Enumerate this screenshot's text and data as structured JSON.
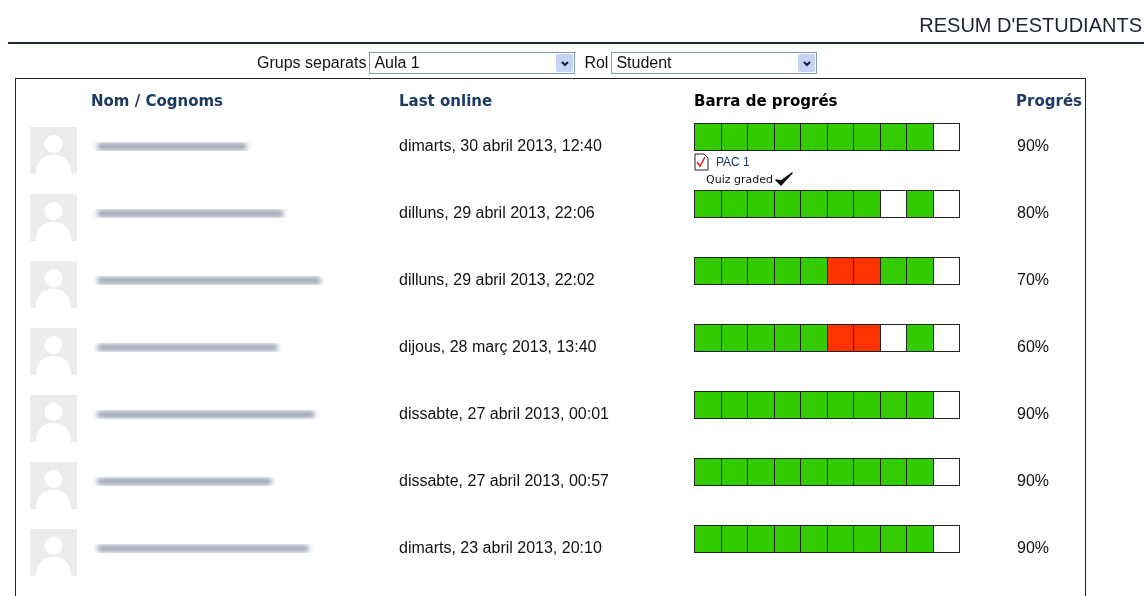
{
  "title": "RESUM D'ESTUDIANTS",
  "filters": [
    {
      "label": "Grups separats",
      "value": "Aula 1"
    },
    {
      "label": "Rol",
      "value": "Student"
    }
  ],
  "table": {
    "columns": [
      {
        "label": "Nom / Cognoms",
        "kind": "link"
      },
      {
        "label": "Last online",
        "kind": "link"
      },
      {
        "label": "Barra de progrés",
        "kind": "plain"
      },
      {
        "label": "Progrés",
        "kind": "link"
      }
    ],
    "rows": [
      {
        "last_online": "dimarts, 30 abril 2013, 12:40",
        "cells": [
          {
            "kind": "done"
          },
          {
            "kind": "done"
          },
          {
            "kind": "done"
          },
          {
            "kind": "done"
          },
          {
            "kind": "done"
          },
          {
            "kind": "done"
          },
          {
            "kind": "done"
          },
          {
            "kind": "done"
          },
          {
            "kind": "done"
          },
          {
            "kind": "pending"
          }
        ],
        "progress": "90%",
        "popup": {
          "activity": "PAC 1",
          "status": "Quiz graded"
        }
      },
      {
        "last_online": "dilluns, 29 abril 2013, 22:06",
        "cells": [
          {
            "kind": "done"
          },
          {
            "kind": "done"
          },
          {
            "kind": "done"
          },
          {
            "kind": "done"
          },
          {
            "kind": "done"
          },
          {
            "kind": "done"
          },
          {
            "kind": "done"
          },
          {
            "kind": "pending"
          },
          {
            "kind": "done"
          },
          {
            "kind": "pending"
          }
        ],
        "progress": "80%"
      },
      {
        "last_online": "dilluns, 29 abril 2013, 22:02",
        "cells": [
          {
            "kind": "done"
          },
          {
            "kind": "done"
          },
          {
            "kind": "done"
          },
          {
            "kind": "done"
          },
          {
            "kind": "done"
          },
          {
            "kind": "failed"
          },
          {
            "kind": "failed"
          },
          {
            "kind": "done"
          },
          {
            "kind": "done"
          },
          {
            "kind": "pending"
          }
        ],
        "progress": "70%"
      },
      {
        "last_online": "dijous, 28 març 2013, 13:40",
        "cells": [
          {
            "kind": "done"
          },
          {
            "kind": "done"
          },
          {
            "kind": "done"
          },
          {
            "kind": "done"
          },
          {
            "kind": "done"
          },
          {
            "kind": "failed"
          },
          {
            "kind": "failed"
          },
          {
            "kind": "pending"
          },
          {
            "kind": "done"
          },
          {
            "kind": "pending"
          }
        ],
        "progress": "60%"
      },
      {
        "last_online": "dissabte, 27 abril 2013, 00:01",
        "cells": [
          {
            "kind": "done"
          },
          {
            "kind": "done"
          },
          {
            "kind": "done"
          },
          {
            "kind": "done"
          },
          {
            "kind": "done"
          },
          {
            "kind": "done"
          },
          {
            "kind": "done"
          },
          {
            "kind": "done"
          },
          {
            "kind": "done"
          },
          {
            "kind": "pending"
          }
        ],
        "progress": "90%"
      },
      {
        "last_online": "dissabte, 27 abril 2013, 00:57",
        "cells": [
          {
            "kind": "done"
          },
          {
            "kind": "done"
          },
          {
            "kind": "done"
          },
          {
            "kind": "done"
          },
          {
            "kind": "done"
          },
          {
            "kind": "done"
          },
          {
            "kind": "done"
          },
          {
            "kind": "done"
          },
          {
            "kind": "done"
          },
          {
            "kind": "pending"
          }
        ],
        "progress": "90%"
      },
      {
        "last_online": "dimarts, 23 abril 2013, 20:10",
        "cells": [
          {
            "kind": "done"
          },
          {
            "kind": "done"
          },
          {
            "kind": "done"
          },
          {
            "kind": "done"
          },
          {
            "kind": "done"
          },
          {
            "kind": "done"
          },
          {
            "kind": "done"
          },
          {
            "kind": "done"
          },
          {
            "kind": "done"
          },
          {
            "kind": "pending"
          }
        ],
        "progress": "90%"
      }
    ]
  }
}
